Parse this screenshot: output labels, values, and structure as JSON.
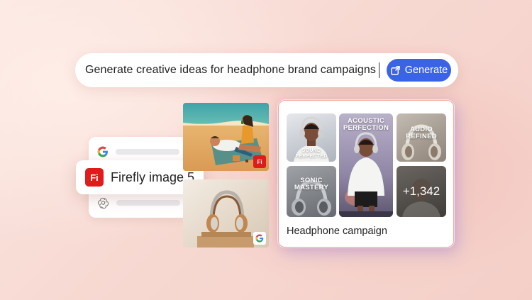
{
  "prompt": {
    "text": "Generate creative ideas for headphone brand campaigns",
    "button_label": "Generate"
  },
  "models": {
    "selected_label": "Firefly image 5",
    "selected_logo_text": "Fi",
    "items": [
      "google",
      "firefly",
      "openai"
    ]
  },
  "images": {
    "beach_badge_text": "Fi"
  },
  "campaign": {
    "title": "Headphone campaign",
    "tiles": {
      "sound_perfected": "SOUND\nPERFECTED",
      "acoustic_perfection": "ACOUSTIC\nPERFECTION",
      "audio_refined": "AUDIO\nREFINED",
      "sonic_mastery": "SONIC\nMASTERY",
      "more_count": "+1,342"
    }
  },
  "colors": {
    "accent_blue": "#3b63e6",
    "firefly_red": "#e01b1b"
  }
}
